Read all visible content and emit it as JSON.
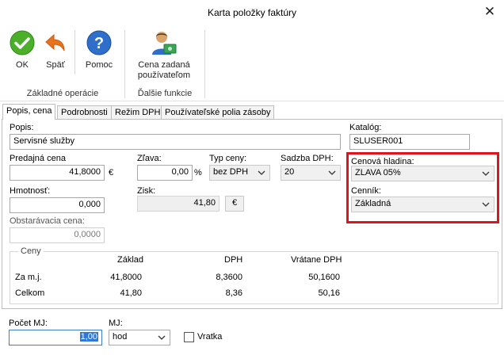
{
  "window": {
    "title": "Karta položky faktúry",
    "close_glyph": "✕"
  },
  "ribbon": {
    "buttons": [
      {
        "label": "OK",
        "icon": "ok-check-icon"
      },
      {
        "label": "Späť",
        "icon": "back-arrow-icon"
      },
      {
        "label": "Pomoc",
        "icon": "help-question-icon"
      },
      {
        "label_line1": "Cena zadaná",
        "label_line2": "používateľom",
        "icon": "user-price-icon"
      }
    ],
    "groups": {
      "basic": "Základné operácie",
      "other": "Ďalšie funkcie"
    }
  },
  "tabs": [
    "Popis, cena",
    "Podrobnosti",
    "Režim DPH",
    "Používateľské polia zásoby"
  ],
  "form": {
    "popis": {
      "label": "Popis:",
      "value": "Servisné služby"
    },
    "katalog": {
      "label": "Katalóg:",
      "value": "SLUSER001"
    },
    "predajna_cena": {
      "label": "Predajná cena",
      "value": "41,8000",
      "unit": "€"
    },
    "zlava": {
      "label": "Zľava:",
      "value": "0,00",
      "unit": "%"
    },
    "typ_ceny": {
      "label": "Typ ceny:",
      "value": "bez DPH"
    },
    "sadzba_dph": {
      "label": "Sadzba DPH:",
      "value": "20"
    },
    "cenova_hladina": {
      "label": "Cenová hladina:",
      "value": "ZLAVA 05%"
    },
    "cennik": {
      "label": "Cenník:",
      "value": "Základná"
    },
    "hmotnost": {
      "label": "Hmotnosť:",
      "value": "0,000"
    },
    "zisk": {
      "label": "Zisk:",
      "value": "41,80",
      "unit_button": "€"
    },
    "obstaravacia_cena": {
      "label": "Obstarávacia cena:",
      "value": "0,0000"
    }
  },
  "ceny": {
    "title": "Ceny",
    "columns": [
      "Základ",
      "DPH",
      "Vrátane DPH"
    ],
    "rows": [
      {
        "label": "Za m.j.",
        "zaklad": "41,8000",
        "dph": "8,3600",
        "spolu": "50,1600"
      },
      {
        "label": "Celkom",
        "zaklad": "41,80",
        "dph": "8,36",
        "spolu": "50,16"
      }
    ]
  },
  "bottom": {
    "pocet_mj": {
      "label": "Počet MJ:",
      "value": "1,00"
    },
    "mj": {
      "label": "MJ:",
      "value": "hod"
    },
    "vratka": {
      "label": "Vratka",
      "checked": false
    }
  },
  "colors": {
    "highlight_border": "#e0141e",
    "ok_green": "#4caf2a",
    "help_blue": "#2f6fc9",
    "back_orange": "#e8731e"
  }
}
